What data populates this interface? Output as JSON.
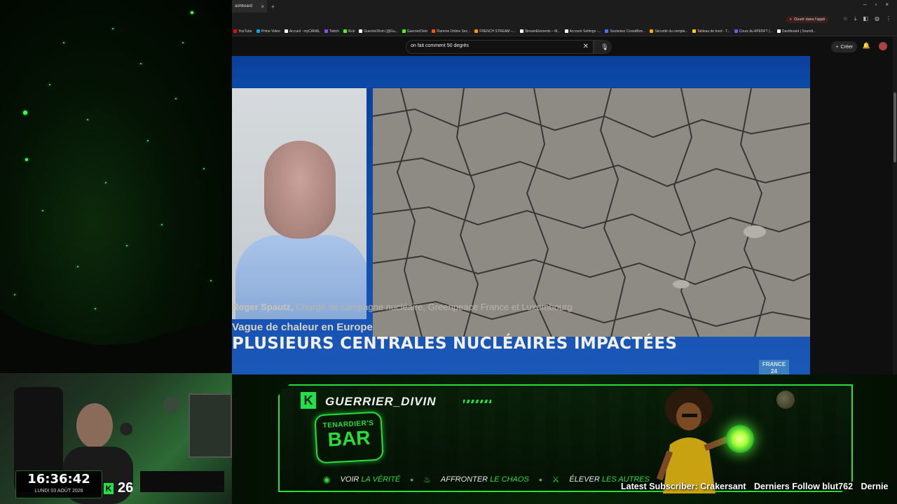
{
  "browser": {
    "tab_title": "ashboard",
    "open_app_label": "Ouvrir dans l'appli",
    "bookmarks": [
      {
        "label": "YouTube",
        "color": "#ff0000"
      },
      {
        "label": "Prime Video",
        "color": "#00a8e1"
      },
      {
        "label": "Accueil - myCANAL",
        "color": "#ffffff"
      },
      {
        "label": "Twitch",
        "color": "#9146ff"
      },
      {
        "label": "Kick",
        "color": "#53fc18"
      },
      {
        "label": "GuerrierDivin (@Gu...",
        "color": "#ffffff"
      },
      {
        "label": "GuerrierDivin",
        "color": "#53fc18"
      },
      {
        "label": "Flamme Online Sec...",
        "color": "#ff5500"
      },
      {
        "label": "FRENCH STREAM –...",
        "color": "#ff9900"
      },
      {
        "label": "StreamElements – M...",
        "color": "#ffffff"
      },
      {
        "label": "Account Settings -...",
        "color": "#ffffff"
      },
      {
        "label": "Souteniez CrowdBon...",
        "color": "#4477ff"
      },
      {
        "label": "Sécurité du compte...",
        "color": "#ffaa00"
      },
      {
        "label": "Tableau de bord - T...",
        "color": "#ffcc00"
      },
      {
        "label": "Cours du APENFT (...",
        "color": "#7755ff"
      },
      {
        "label": "Dashboard | Soundl...",
        "color": "#ffffff"
      }
    ]
  },
  "youtube": {
    "search_query": "on fait comment 50 degrés",
    "create_label": "Créer"
  },
  "video": {
    "name": "Roger Spautz",
    "name_visible": "Roger Spautz,",
    "role": " Chargé de campagne nucléaire, Greenpeace France et Luxembourg",
    "subtitle": "Vague de chaleur en Europe",
    "headline": "PLUSIEURS CENTRALES NUCLÉAIRES IMPACTÉES",
    "logo": "FRANCE 24"
  },
  "overlay": {
    "username": "GUERRIER_DIVIN",
    "bar_top": "TENARDIER'S",
    "bar_main": "BAR",
    "taglines": [
      {
        "verb": "VOIR ",
        "highlight": "LA VÉRITÉ"
      },
      {
        "verb": "AFFRONTER ",
        "highlight": "LE CHAOS"
      },
      {
        "verb": "ÉLEVER ",
        "highlight": "LES AUTRES"
      }
    ],
    "ticker": {
      "latest_subscriber": "Latest Subscriber: Crakersant",
      "derniers_follow": "Derniers Follow blut762",
      "trailing": "Dernie"
    }
  },
  "webcam": {
    "time": "16:36:42",
    "date": "LUNDI 03 AOÛT 2026",
    "kick_count": "26"
  },
  "colors": {
    "accent_green": "#2bdc3a",
    "f24_blue": "#0b3f9c"
  }
}
